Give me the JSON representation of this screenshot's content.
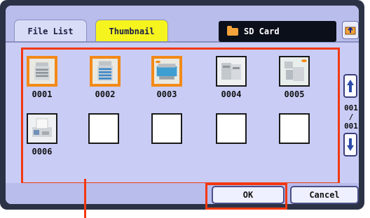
{
  "tabs": [
    {
      "label": "File List",
      "active": false
    },
    {
      "label": "Thumbnail",
      "active": true
    }
  ],
  "media": {
    "label": "SD Card",
    "icon": "folder-icon"
  },
  "thumbnails": [
    {
      "label": "0001",
      "selected": true,
      "type": "copier"
    },
    {
      "label": "0002",
      "selected": true,
      "type": "copier-blue"
    },
    {
      "label": "0003",
      "selected": true,
      "type": "printer-blue"
    },
    {
      "label": "0004",
      "selected": false,
      "type": "copier-large"
    },
    {
      "label": "0005",
      "selected": false,
      "type": "copier-multi"
    },
    {
      "label": "0006",
      "selected": false,
      "type": "fax"
    },
    {
      "label": "",
      "selected": false,
      "type": "empty"
    },
    {
      "label": "",
      "selected": false,
      "type": "empty"
    },
    {
      "label": "",
      "selected": false,
      "type": "empty"
    },
    {
      "label": "",
      "selected": false,
      "type": "empty"
    }
  ],
  "page_indicator": {
    "current": "001",
    "separator": "/",
    "total": "001"
  },
  "buttons": {
    "ok": "OK",
    "cancel": "Cancel"
  },
  "colors": {
    "highlight": "#f23810",
    "selected": "#f38a18",
    "active_tab": "#f6f41f"
  }
}
